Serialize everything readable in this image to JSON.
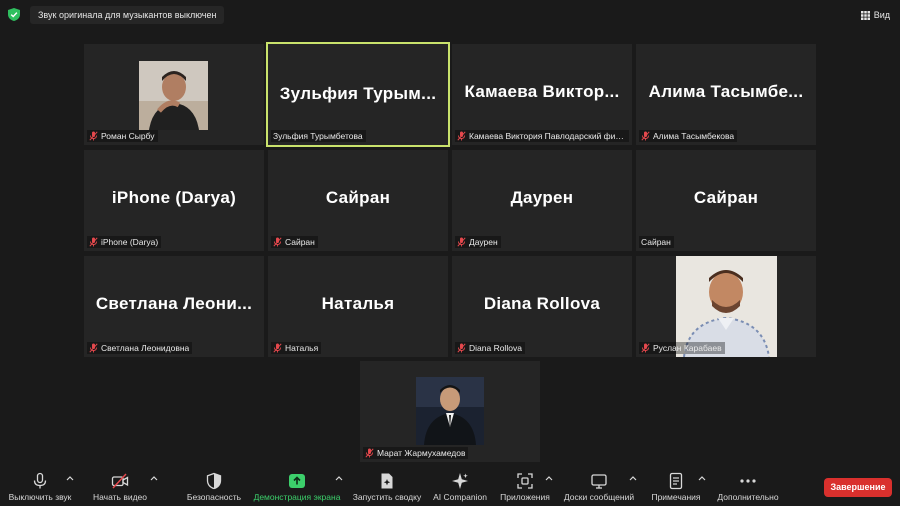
{
  "topbar": {
    "notice": "Звук оригинала для музыкантов выключен",
    "view_label": "Вид"
  },
  "tiles": [
    {
      "display": "",
      "label": "Роман Сырбу",
      "muted": true
    },
    {
      "display": "Зульфия Турым...",
      "label": "Зульфия Турымбетова",
      "muted": false
    },
    {
      "display": "Камаева Виктор...",
      "label": "Камаева Виктория Павлодарский фил...",
      "muted": true
    },
    {
      "display": "Алима Тасымбе...",
      "label": "Алима Тасымбекова",
      "muted": true
    },
    {
      "display": "iPhone (Darya)",
      "label": "iPhone (Darya)",
      "muted": true
    },
    {
      "display": "Сайран",
      "label": "Сайран",
      "muted": true
    },
    {
      "display": "Даурен",
      "label": "Даурен",
      "muted": true
    },
    {
      "display": "Сайран",
      "label": "Сайран",
      "muted": false
    },
    {
      "display": "Светлана Леони...",
      "label": "Светлана Леонидовна",
      "muted": true
    },
    {
      "display": "Наталья",
      "label": "Наталья",
      "muted": true
    },
    {
      "display": "Diana Rollova",
      "label": "Diana Rollova",
      "muted": true
    },
    {
      "display": "",
      "label": "Руслан Карабаев",
      "muted": true
    },
    {
      "display": "",
      "label": "Марат Жармухамедов",
      "muted": true
    }
  ],
  "toolbar": {
    "mute": "Выключить звук",
    "video": "Начать видео",
    "security": "Безопасность",
    "share": "Демонстрация экрана",
    "summary": "Запустить сводку",
    "companion": "AI Companion",
    "apps": "Приложения",
    "whiteboards": "Доски сообщений",
    "notes": "Примечания",
    "more": "Дополнительно",
    "end": "Завершение"
  },
  "colors": {
    "active_border": "#c9e26c",
    "share_green": "#3ccf6b",
    "end_red": "#d9302d",
    "mute_red": "#e5484d"
  }
}
